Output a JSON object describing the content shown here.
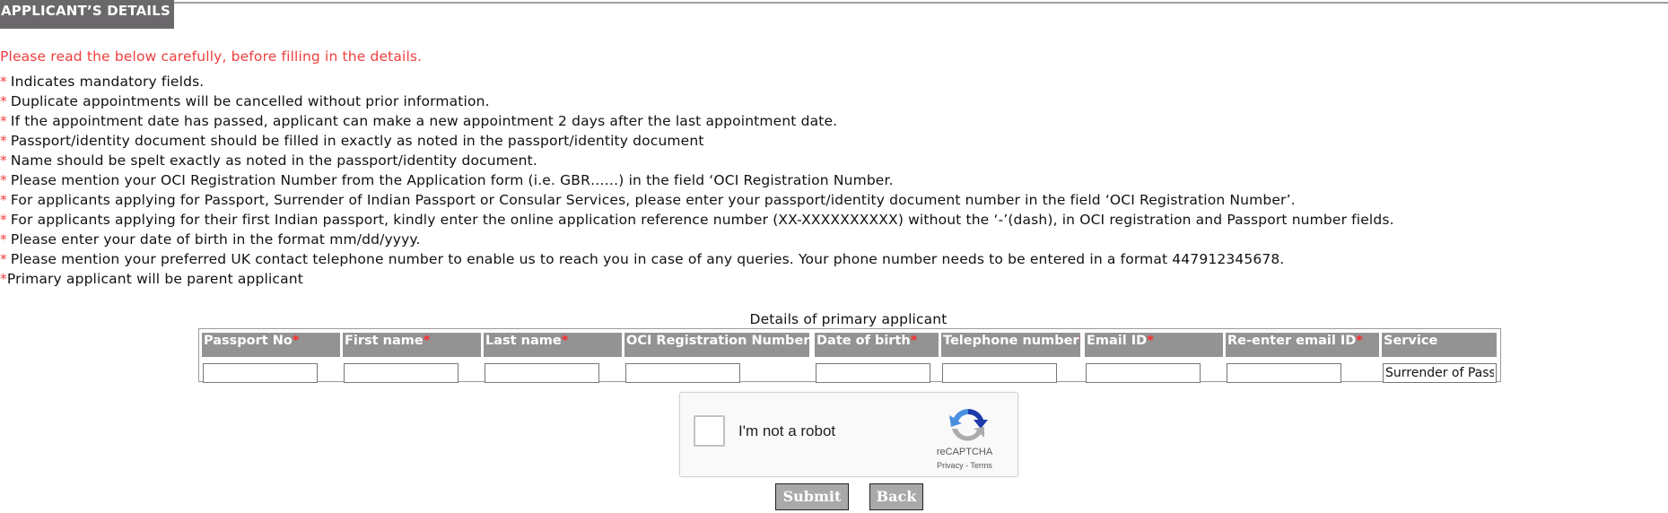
{
  "header": {
    "title": "APPLICANT’S DETAILS"
  },
  "notice": "Please read the below carefully, before filling in the details.",
  "rules": [
    "Indicates mandatory fields.",
    "Duplicate appointments will be cancelled without prior information.",
    "If the appointment date has passed, applicant can make a new appointment 2 days after the last appointment date.",
    "Passport/identity document should be filled in exactly as noted in the passport/identity document",
    "Name should be spelt exactly as noted in the passport/identity document.",
    "Please mention your OCI Registration Number from the Application form (i.e. GBR……) in the field ‘OCI Registration Number.",
    "For applicants applying for Passport, Surrender of Indian Passport or Consular Services, please enter your passport/identity document number in the field ‘OCI Registration Number’.",
    "For applicants applying for their first Indian passport, kindly enter the online application reference number (XX-XXXXXXXXXX) without the ‘-’(dash), in OCI registration and Passport number fields.",
    "Please enter your date of birth in the format mm/dd/yyyy.",
    "Please mention your preferred UK contact telephone number to enable us to reach you in case of any queries. Your phone number needs to be entered in a format 447912345678.",
    "Primary applicant will be parent applicant"
  ],
  "required_marker": "*",
  "table": {
    "caption": "Details of primary applicant",
    "columns": [
      {
        "label": "Passport No",
        "required": "*",
        "value": ""
      },
      {
        "label": "First name",
        "required": "*",
        "value": ""
      },
      {
        "label": "Last name",
        "required": "*",
        "value": ""
      },
      {
        "label": "OCI Registration Number",
        "required": "*",
        "value": ""
      },
      {
        "label": "Date of birth",
        "required": "*",
        "value": ""
      },
      {
        "label": "Telephone number",
        "required": "*",
        "value": ""
      },
      {
        "label": "Email ID",
        "required": "*",
        "value": ""
      },
      {
        "label": "Re-enter email ID",
        "required": "*",
        "value": ""
      },
      {
        "label": "Service",
        "required": "",
        "value": "Surrender of Passport"
      }
    ]
  },
  "recaptcha": {
    "label": "I'm not a robot",
    "brand": "reCAPTCHA",
    "privacy": "Privacy",
    "separator": " - ",
    "terms": "Terms"
  },
  "buttons": {
    "submit": "Submit",
    "back": "Back"
  },
  "colors": {
    "accent_red": "#f0403e",
    "header_bg": "#6a686b",
    "column_header_bg": "#939393",
    "button_bg": "#a9a9a9"
  }
}
